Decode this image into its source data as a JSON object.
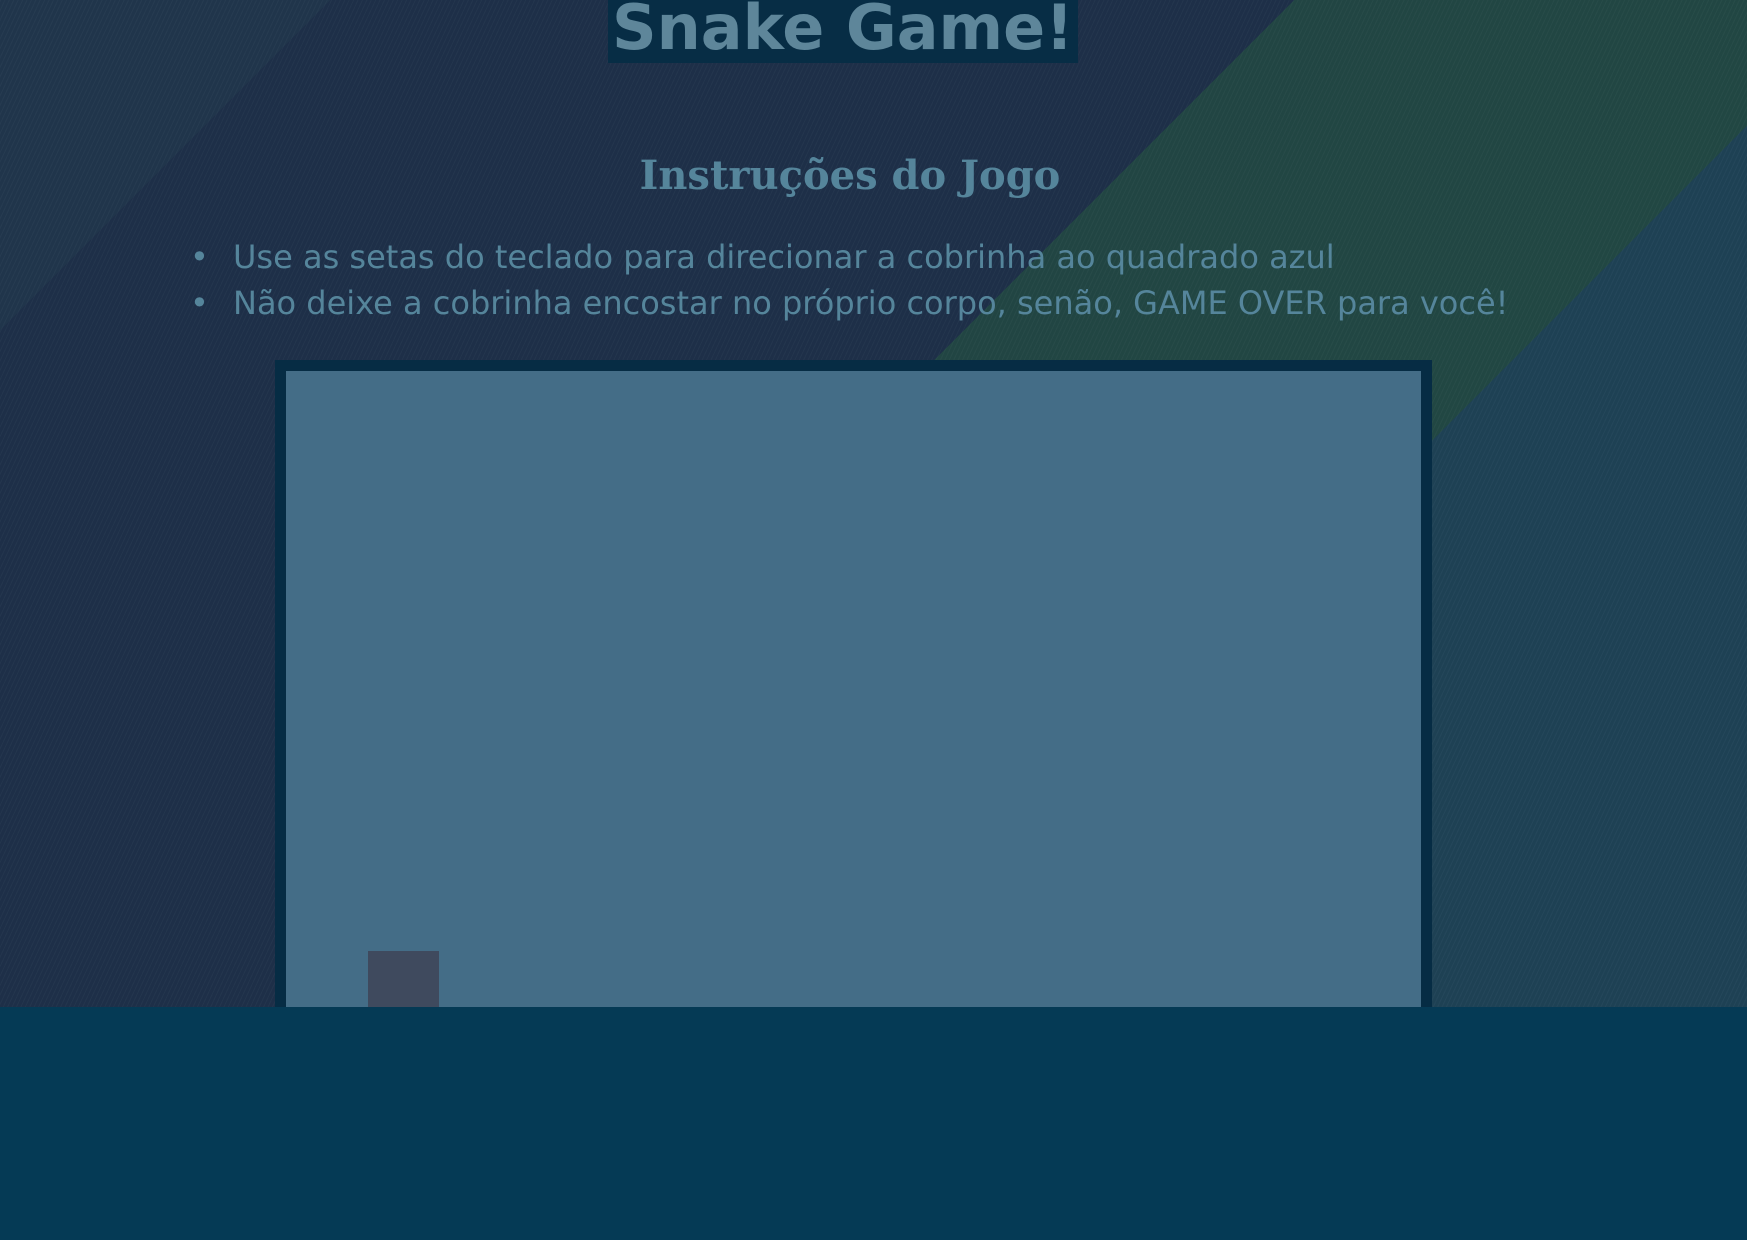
{
  "page": {
    "title": "Snake Game!",
    "subtitle": "Instruções do Jogo",
    "instructions": [
      "Use as setas do teclado para direcionar a cobrinha ao quadrado azul",
      "Não deixe a cobrinha encostar no próprio corpo, senão, GAME OVER para você!"
    ]
  },
  "colors": {
    "footer": "#053a55",
    "board_fill": "#446d87",
    "board_border": "#062c44",
    "food": "#3f4a5e",
    "text": "#55859b"
  }
}
